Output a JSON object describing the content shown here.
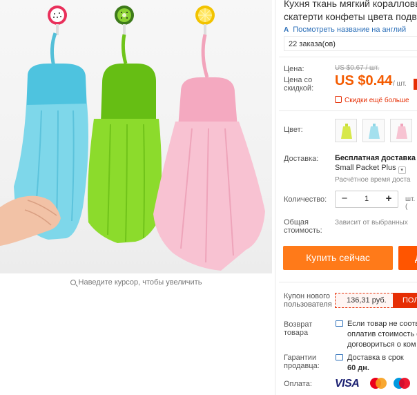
{
  "product": {
    "title_line1": "Кухня ткань мягкий коралловы",
    "title_line2": "скатерти конфеты цвета подве",
    "translate_link": "Посмотреть название на англий",
    "orders": "22 заказа(ов)"
  },
  "image": {
    "zoom_hint": "Наведите курсор, чтобы увеличить"
  },
  "price": {
    "label": "Цена:",
    "old": "US $0.67 / шт.",
    "discount_label_1": "Цена со",
    "discount_label_2": "скидкой:",
    "new": "US $0.44",
    "unit": "/ шт.",
    "promo": "Скидки ещё больше"
  },
  "color": {
    "label": "Цвет:",
    "swatches": [
      "yellow-green",
      "light-blue",
      "pink"
    ]
  },
  "delivery": {
    "label": "Доставка:",
    "title": "Бесплатная доставка",
    "method": "Small Packet Plus",
    "time": "Расчётное время доста"
  },
  "quantity": {
    "label": "Количество:",
    "minus": "−",
    "value": "1",
    "plus": "+",
    "unit": "шт. ("
  },
  "total": {
    "label_1": "Общая",
    "label_2": "стоимость:",
    "value": "Зависит от выбранных"
  },
  "actions": {
    "buy_now": "Купить сейчас",
    "add_to_cart": "Д"
  },
  "coupon": {
    "label_1": "Купон нового",
    "label_2": "пользователя",
    "value": "136,31 руб.",
    "button": "ПОЛ"
  },
  "returns": {
    "label_1": "Возврат",
    "label_2": "товара",
    "line1": "Если товар не соотв",
    "line2": "оплатив стоимость с",
    "line3": "договориться о ком"
  },
  "guarantee": {
    "label_1": "Гарантии",
    "label_2": "продавца:",
    "line1": "Доставка в срок",
    "line2": "60 дн."
  },
  "payment": {
    "label": "Оплата:",
    "visa": "VISA",
    "methods": [
      "VISA",
      "MasterCard",
      "Maestro"
    ]
  },
  "colors": {
    "accent_orange": "#ff7a19",
    "price_red": "#f45b00",
    "link_blue": "#2a6eb8",
    "towel_blue": "#6cd0e6",
    "towel_green": "#7dd31a",
    "towel_pink": "#f6b4c8"
  }
}
